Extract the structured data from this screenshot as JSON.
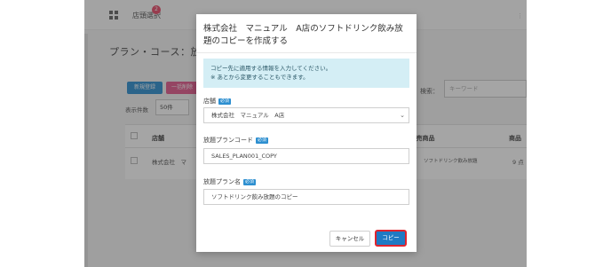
{
  "topbar": {
    "store_select_label": "店頭選択",
    "notification_count": "2"
  },
  "page": {
    "title": "プラン・コース：放題",
    "new_button": "新規登録",
    "bulk_delete_button": "一括削除",
    "count_label": "表示件数",
    "count_value": "50件",
    "search_label": "検索：",
    "search_placeholder": "キーワード"
  },
  "table": {
    "headers": [
      "店舗",
      "/販売商品",
      "商品"
    ],
    "row": {
      "store": "株式会社　マ",
      "product": "ソフトドリンク飲み放題",
      "count": "9 点"
    }
  },
  "modal": {
    "title": "株式会社　マニュアル　A店のソフトドリンク飲み放題のコピーを作成する",
    "info_line1": "コピー先に適用する情報を入力してください。",
    "info_line2": "※ あとから変更することもできます。",
    "required_tag": "必須",
    "store_label": "店舗",
    "store_value": "株式会社　マニュアル　A店",
    "plan_code_label": "放題プランコード",
    "plan_code_value": "SALES_PLAN001_COPY",
    "plan_name_label": "放題プラン名",
    "plan_name_value": "ソフトドリンク飲み放題のコピー",
    "cancel_button": "キャンセル",
    "copy_button": "コピー"
  },
  "colors": {
    "primary": "#2d8fd0",
    "danger": "#e45a8e",
    "highlight": "#e0242e",
    "info_bg": "#d4eef5"
  }
}
